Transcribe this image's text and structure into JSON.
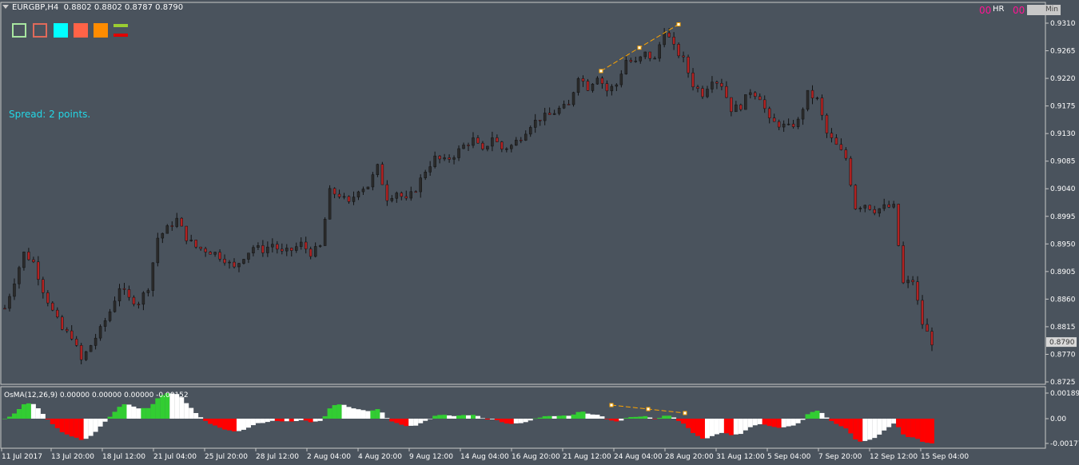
{
  "window": {
    "symbol": "EURGBP,H4",
    "ohlc": "0.8802 0.8802 0.8787 0.8790",
    "spread": "Spread: 2 points.",
    "hr_prefix": "00",
    "hr_label": "HR",
    "min_prefix": "00",
    "min_label": "Min"
  },
  "legend": {
    "boxes": [
      {
        "name": "outline-green",
        "color": "#a8e6a0",
        "style": "outline"
      },
      {
        "name": "outline-red",
        "color": "#e06a5a",
        "style": "outline"
      },
      {
        "name": "fill-cyan",
        "color": "#00ffff",
        "style": "fill"
      },
      {
        "name": "fill-tomato",
        "color": "#ff6347",
        "style": "fill"
      },
      {
        "name": "fill-orange",
        "color": "#ff8c00",
        "style": "fill"
      }
    ],
    "lines": [
      {
        "color": "#9acd32"
      },
      {
        "color": "#e00000"
      }
    ]
  },
  "chart_data": {
    "type": "candlestick",
    "symbol": "EURGBP",
    "timeframe": "H4",
    "price_axis": {
      "min": 0.8725,
      "max": 0.931,
      "ticks": [
        "0.9310",
        "0.9265",
        "0.9220",
        "0.9175",
        "0.9130",
        "0.9085",
        "0.9040",
        "0.8995",
        "0.8950",
        "0.8905",
        "0.8860",
        "0.8815",
        "0.8770",
        "0.8725"
      ],
      "current_price": "0.8790"
    },
    "time_axis": {
      "labels": [
        "11 Jul 2017",
        "13 Jul 20:00",
        "18 Jul 12:00",
        "21 Jul 04:00",
        "25 Jul 20:00",
        "28 Jul 12:00",
        "2 Aug 04:00",
        "4 Aug 20:00",
        "9 Aug 12:00",
        "14 Aug 04:00",
        "16 Aug 20:00",
        "21 Aug 12:00",
        "24 Aug 04:00",
        "28 Aug 20:00",
        "31 Aug 12:00",
        "5 Sep 04:00",
        "7 Sep 20:00",
        "12 Sep 12:00",
        "15 Sep 04:00"
      ]
    },
    "close_path": [
      [
        0,
        0.8845
      ],
      [
        2,
        0.889
      ],
      [
        4,
        0.8935
      ],
      [
        6,
        0.892
      ],
      [
        8,
        0.8875
      ],
      [
        10,
        0.884
      ],
      [
        12,
        0.881
      ],
      [
        14,
        0.88
      ],
      [
        16,
        0.876
      ],
      [
        18,
        0.8785
      ],
      [
        20,
        0.881
      ],
      [
        22,
        0.884
      ],
      [
        24,
        0.888
      ],
      [
        26,
        0.886
      ],
      [
        28,
        0.8855
      ],
      [
        30,
        0.888
      ],
      [
        32,
        0.896
      ],
      [
        34,
        0.8975
      ],
      [
        36,
        0.899
      ],
      [
        38,
        0.896
      ],
      [
        40,
        0.8945
      ],
      [
        42,
        0.894
      ],
      [
        44,
        0.8935
      ],
      [
        46,
        0.8925
      ],
      [
        48,
        0.891
      ],
      [
        50,
        0.893
      ],
      [
        52,
        0.8945
      ],
      [
        54,
        0.894
      ],
      [
        56,
        0.895
      ],
      [
        58,
        0.8935
      ],
      [
        60,
        0.894
      ],
      [
        62,
        0.895
      ],
      [
        64,
        0.8935
      ],
      [
        66,
        0.8945
      ],
      [
        68,
        0.9035
      ],
      [
        70,
        0.903
      ],
      [
        72,
        0.9015
      ],
      [
        74,
        0.904
      ],
      [
        76,
        0.9045
      ],
      [
        78,
        0.9075
      ],
      [
        80,
        0.9025
      ],
      [
        82,
        0.9035
      ],
      [
        84,
        0.902
      ],
      [
        86,
        0.904
      ],
      [
        88,
        0.907
      ],
      [
        90,
        0.909
      ],
      [
        92,
        0.9085
      ],
      [
        94,
        0.9095
      ],
      [
        96,
        0.911
      ],
      [
        98,
        0.912
      ],
      [
        100,
        0.91
      ],
      [
        102,
        0.9125
      ],
      [
        104,
        0.9105
      ],
      [
        106,
        0.911
      ],
      [
        108,
        0.9125
      ],
      [
        110,
        0.9145
      ],
      [
        112,
        0.9155
      ],
      [
        114,
        0.916
      ],
      [
        116,
        0.917
      ],
      [
        118,
        0.9175
      ],
      [
        120,
        0.9225
      ],
      [
        122,
        0.9205
      ],
      [
        124,
        0.9225
      ],
      [
        126,
        0.92
      ],
      [
        128,
        0.921
      ],
      [
        130,
        0.925
      ],
      [
        132,
        0.9245
      ],
      [
        134,
        0.926
      ],
      [
        136,
        0.925
      ],
      [
        138,
        0.93
      ],
      [
        140,
        0.927
      ],
      [
        142,
        0.925
      ],
      [
        144,
        0.921
      ],
      [
        146,
        0.9195
      ],
      [
        148,
        0.922
      ],
      [
        150,
        0.921
      ],
      [
        152,
        0.917
      ],
      [
        154,
        0.9175
      ],
      [
        156,
        0.92
      ],
      [
        158,
        0.919
      ],
      [
        160,
        0.915
      ],
      [
        162,
        0.9145
      ],
      [
        164,
        0.914
      ],
      [
        166,
        0.915
      ],
      [
        168,
        0.9195
      ],
      [
        170,
        0.9185
      ],
      [
        172,
        0.913
      ],
      [
        174,
        0.911
      ],
      [
        176,
        0.909
      ],
      [
        178,
        0.901
      ],
      [
        180,
        0.9015
      ],
      [
        182,
        0.9005
      ],
      [
        184,
        0.901
      ],
      [
        186,
        0.901
      ],
      [
        188,
        0.8885
      ],
      [
        190,
        0.889
      ],
      [
        192,
        0.882
      ],
      [
        194,
        0.879
      ]
    ],
    "annotations": {
      "price_divergence_points": [
        {
          "time": "24 Aug 04:00",
          "price": 0.9232
        },
        {
          "time": "25 Aug",
          "price": 0.927
        },
        {
          "time": "28 Aug 20:00",
          "price": 0.9308
        }
      ]
    }
  },
  "oscillator": {
    "label": "OsMA(12,26,9) 0.00000 0.00000 0.00000 -0.00152",
    "ticks": [
      "0.00189",
      "0.00",
      "-0.00177"
    ],
    "max": 0.00189,
    "min": -0.00177,
    "colors": {
      "up_green": "#32cd32",
      "up_white": "#ffffff",
      "down_red": "#ff0000",
      "down_white": "#ffffff"
    }
  },
  "colors": {
    "background": "#4a535d",
    "grid_frame": "#c8c8c8",
    "bull_candle": "#2b2b2b",
    "bear_candle": "#b22222",
    "wick": "#111111",
    "divergence_line": "#ffa500"
  }
}
